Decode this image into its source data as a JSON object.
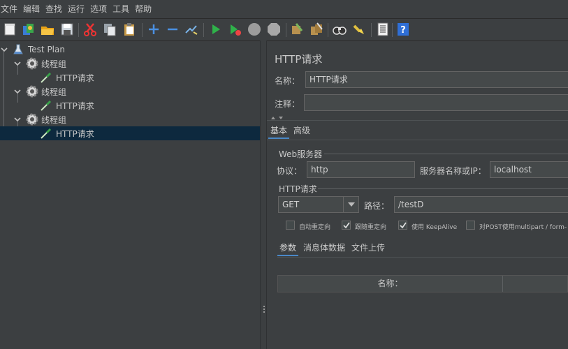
{
  "menu": [
    "文件",
    "编辑",
    "查找",
    "运行",
    "选项",
    "工具",
    "帮助"
  ],
  "toolbar_icons": [
    "new-icon",
    "templates-icon",
    "open-icon",
    "save-icon",
    "cut-icon",
    "copy-icon",
    "paste-icon",
    "expand-icon",
    "collapse-icon",
    "toggle-icon",
    "start-icon",
    "start-no-pause-icon",
    "stop-icon",
    "shutdown-icon",
    "clear-icon",
    "clear-all-icon",
    "search-icon",
    "reset-search-icon",
    "function-helper-icon",
    "help-icon"
  ],
  "tree": {
    "root": "Test Plan",
    "thread_group_label": "线程组",
    "sampler_label": "HTTP请求"
  },
  "panel": {
    "title": "HTTP请求",
    "name_label": "名称：",
    "name_value": "HTTP请求",
    "comment_label": "注释：",
    "comment_value": ""
  },
  "tabs": {
    "basic": "基本",
    "advanced": "高级"
  },
  "web_server": {
    "group_title": "Web服务器",
    "protocol_label": "协议：",
    "protocol_value": "http",
    "server_label": "服务器名称或IP：",
    "server_value": "localhost"
  },
  "http_request": {
    "group_title": "HTTP请求",
    "method_value": "GET",
    "path_label": "路径：",
    "path_value": "/testD"
  },
  "checkboxes": [
    {
      "label": "自动重定向",
      "checked": false
    },
    {
      "label": "跟随重定向",
      "checked": true
    },
    {
      "label": "使用 KeepAlive",
      "checked": true
    },
    {
      "label": "对POST使用multipart / form-",
      "checked": false
    }
  ],
  "sub_tabs": {
    "params": "参数",
    "body": "消息体数据",
    "files": "文件上传"
  },
  "table": {
    "col_name": "名称："
  },
  "colors": {
    "background": "#3c3f41",
    "selection": "#0d293e",
    "accent": "#4a88c7"
  }
}
